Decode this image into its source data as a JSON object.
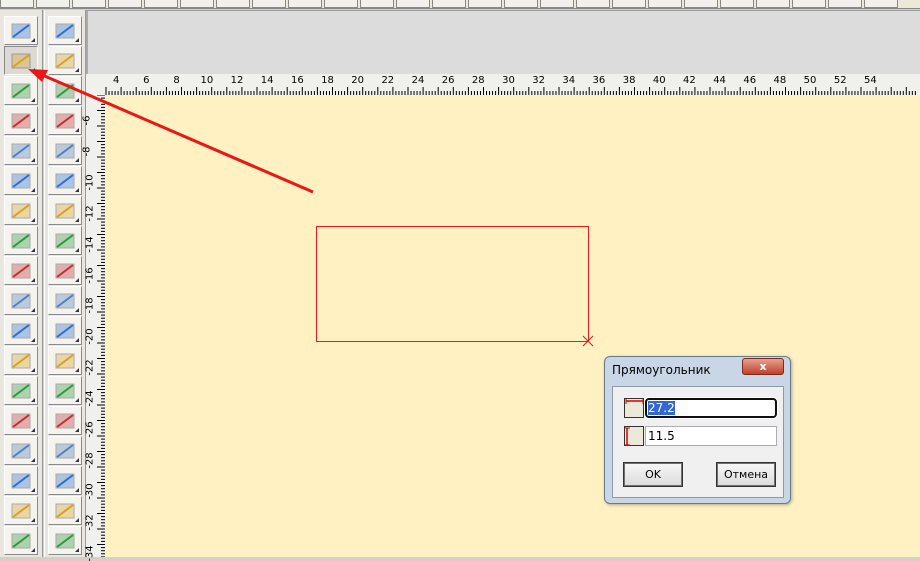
{
  "canvas_color": "#fff1c1",
  "accent": "#ff0000",
  "ruler": {
    "top_labels": [
      "4",
      "6",
      "8",
      "10",
      "12",
      "14",
      "16",
      "18",
      "20",
      "22",
      "24",
      "26",
      "28",
      "30",
      "32",
      "34",
      "36",
      "38",
      "40",
      "42",
      "44",
      "46",
      "48",
      "50",
      "52",
      "54"
    ],
    "left_labels": [
      "-6",
      "-8",
      "-10",
      "-12",
      "-14",
      "-16",
      "-18",
      "-20",
      "-22",
      "-24",
      "-26",
      "-28",
      "-30",
      "-32",
      "-34"
    ]
  },
  "tools_left": [
    "select-icon",
    "pencil-icon",
    "rectangle-icon",
    "curve-point-icon",
    "intersection-icon",
    "chain-icon",
    "compass-icon",
    "cut-curve-icon",
    "eraser-icon",
    "dart-icon",
    "piece-icon",
    "parallel-icon",
    "flare-icon",
    "spiral-icon",
    "measure-tape-icon",
    "rotate-triangle-icon",
    "scissors-icon",
    "seam-lines-icon"
  ],
  "tools_right": [
    "select-frame-icon",
    "pocket-icon",
    "piece-outline-icon",
    "shirt-piece-icon",
    "grade-icon",
    "length-measure-icon",
    "button-icon",
    "grid-piece-icon",
    "point-edit-icon",
    "sewing-machine-icon",
    "notch-icon",
    "flip-icon",
    "mirror-piece-icon",
    "align-points-icon",
    "corner-round-icon",
    "add-piece-icon",
    "label-piece-icon",
    "piece-group-icon"
  ],
  "dialog": {
    "title": "Прямоугольник",
    "close": "x",
    "width_value": "27.2",
    "height_value": "11.5",
    "ok": "OK",
    "cancel": "Отмена"
  }
}
